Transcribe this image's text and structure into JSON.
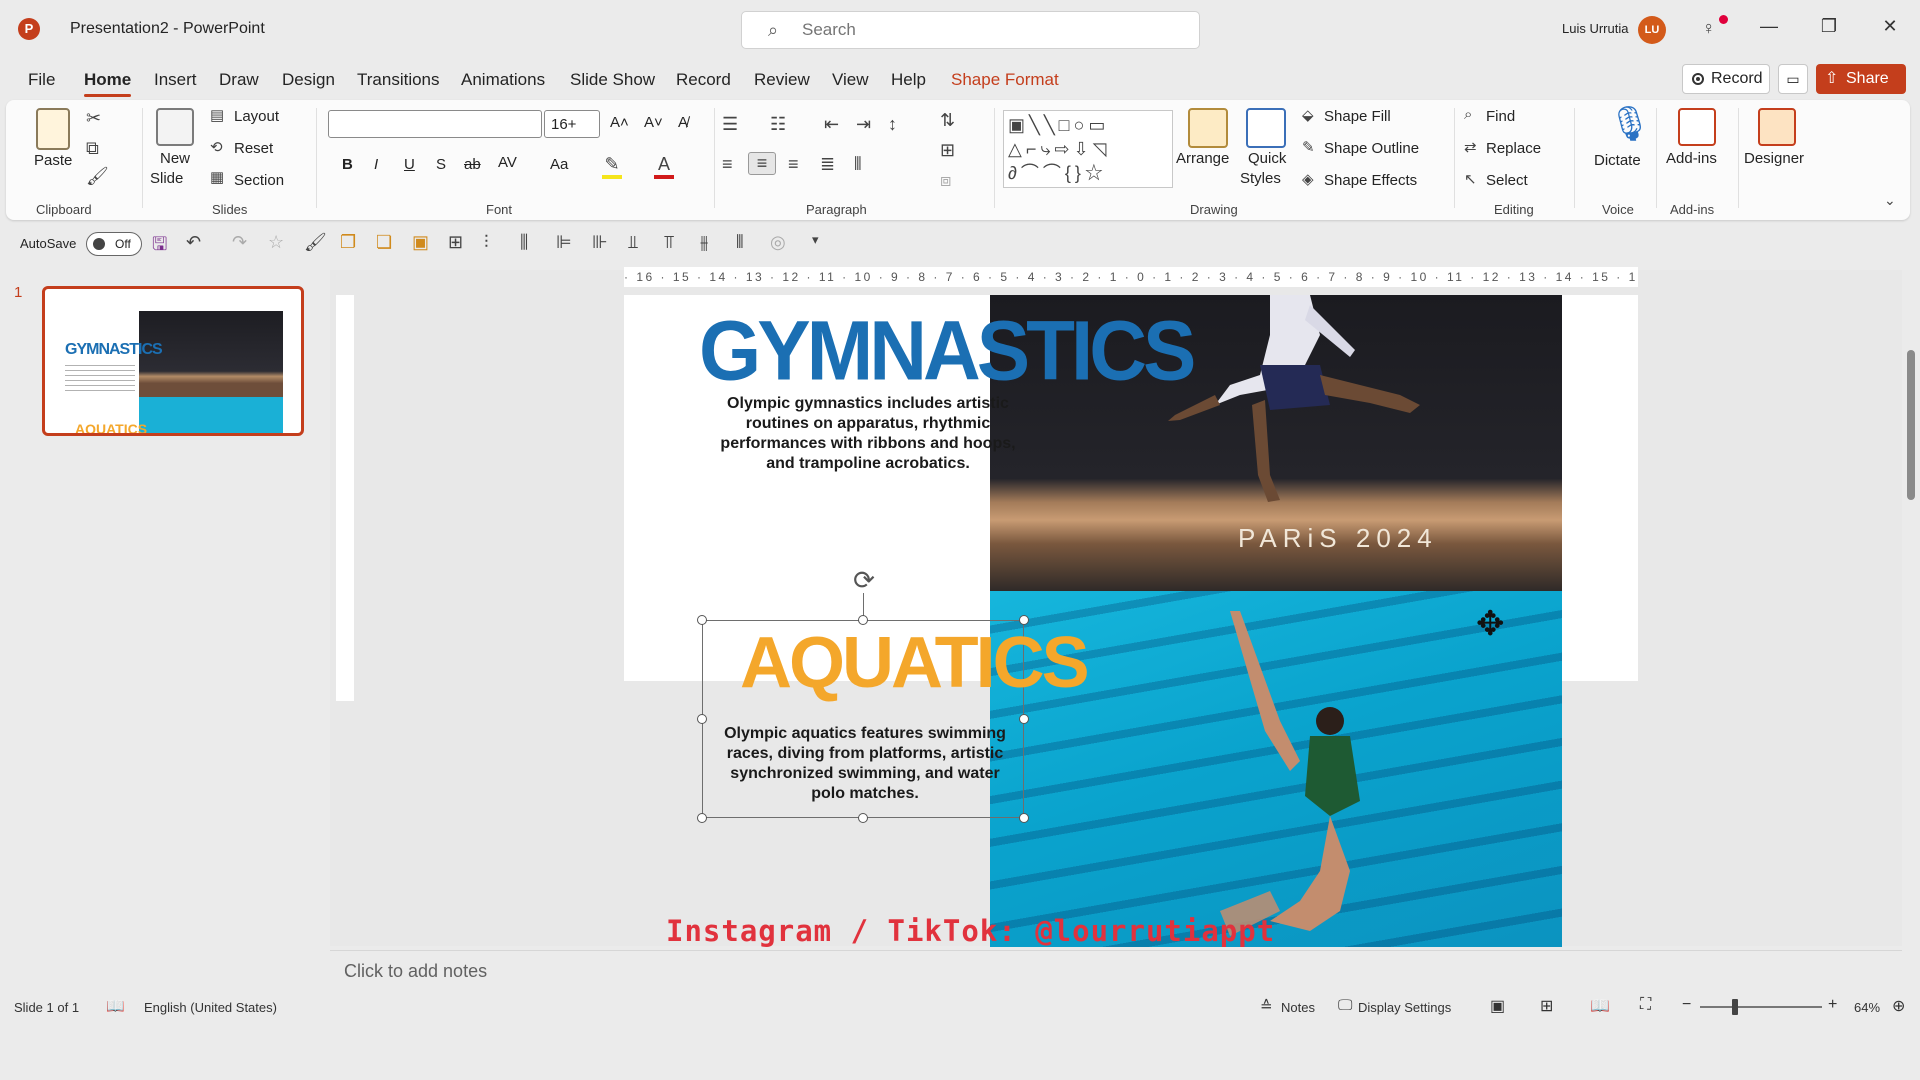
{
  "titlebar": {
    "title": "Presentation2  -  PowerPoint",
    "search_placeholder": "Search",
    "user_name": "Luis Urrutia",
    "user_initials": "LU"
  },
  "tabs": [
    "File",
    "Home",
    "Insert",
    "Draw",
    "Design",
    "Transitions",
    "Animations",
    "Slide Show",
    "Record",
    "Review",
    "View",
    "Help",
    "Shape Format"
  ],
  "actions": {
    "record": "Record",
    "share": "Share"
  },
  "ribbon": {
    "clipboard": {
      "paste": "Paste",
      "label": "Clipboard"
    },
    "slides": {
      "new_slide_1": "New",
      "new_slide_2": "Slide",
      "layout": "Layout",
      "reset": "Reset",
      "section": "Section",
      "label": "Slides"
    },
    "font": {
      "size": "16+",
      "bold": "B",
      "italic": "I",
      "underline": "U",
      "shadow": "S",
      "strike": "ab",
      "spacing": "AV",
      "case": "Aa",
      "label": "Font"
    },
    "paragraph": {
      "label": "Paragraph"
    },
    "drawing": {
      "arrange": "Arrange",
      "quick_1": "Quick",
      "quick_2": "Styles",
      "shape_fill": "Shape Fill",
      "shape_outline": "Shape Outline",
      "shape_effects": "Shape Effects",
      "label": "Drawing"
    },
    "editing": {
      "find": "Find",
      "replace": "Replace",
      "select": "Select",
      "label": "Editing"
    },
    "voice": {
      "dictate": "Dictate",
      "label": "Voice"
    },
    "addins": {
      "addins": "Add-ins",
      "label": "Add-ins"
    },
    "designer": {
      "designer": "Designer"
    }
  },
  "qat": {
    "autosave": "AutoSave",
    "toggle_state": "Off"
  },
  "thumbnails": {
    "slide_number": "1",
    "t1": "GYMNASTICS",
    "t2": "AQUATICS"
  },
  "slide": {
    "gym_title": "GYMNASTICS",
    "gym_body": "Olympic gymnastics includes artistic routines on apparatus, rhythmic performances with ribbons and hoops, and trampoline acrobatics.",
    "photo_caption": "PARiS 2024",
    "aq_title": "AQUATICS",
    "aq_body": "Olympic aquatics features swimming races, diving from platforms, artistic synchronized swimming, and water polo matches.",
    "watermark": "Instagram / TikTok: @lourrutiappt"
  },
  "ruler_h": "· 16 · 15 · 14 · 13 · 12 · 11 · 10 · 9 · 8 · 7 · 6 · 5 · 4 · 3 · 2 · 1 · 0 · 1 · 2 · 3 · 4 · 5 · 6 · 7 · 8 · 9 · 10 · 11 · 12 · 13 · 14 · 15 · 16 ·",
  "notes": {
    "placeholder": "Click to add notes"
  },
  "status": {
    "slide_info": "Slide 1 of 1",
    "language": "English (United States)",
    "notes": "Notes",
    "display_settings": "Display Settings",
    "zoom": "64%"
  },
  "colors": {
    "accent": "#c43e1c",
    "gym_blue": "#1b6fb3",
    "aquatics_orange": "#f4a72b",
    "watermark_red": "#e1323d"
  }
}
